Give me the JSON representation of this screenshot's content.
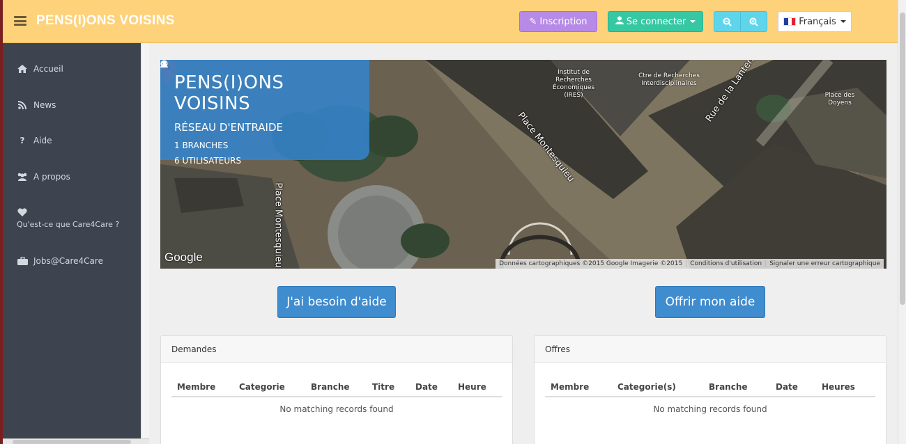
{
  "header": {
    "brand": "PENS(I)ONS VOISINS",
    "signup_label": "Inscription",
    "login_label": "Se connecter",
    "language_label": "Français"
  },
  "sidebar": {
    "items": [
      {
        "label": "Accueil",
        "icon": "home-icon"
      },
      {
        "label": "News",
        "icon": "rss-icon"
      },
      {
        "label": "Aide",
        "icon": "question-icon"
      },
      {
        "label": "A propos",
        "icon": "users-icon"
      },
      {
        "label": "Qu'est-ce que Care4Care ?",
        "icon": "heart-icon"
      },
      {
        "label": "Jobs@Care4Care",
        "icon": "briefcase-icon"
      }
    ]
  },
  "map": {
    "title": "PENS(I)ONS VOISINS",
    "subtitle": "RÉSEAU D'ENTRAIDE",
    "branches": "1 BRANCHES",
    "users": "6 UTILISATEURS",
    "google_logo": "Google",
    "footer_data": "Données cartographiques ©2015 Google Imagerie ©2015",
    "footer_terms": "Conditions d'utilisation",
    "footer_report": "Signaler une erreur cartographique",
    "labels": {
      "ires": "Institut de Recherches Économiques (IRES)",
      "ctre": "Ctre de Recherches Interdisciplinaires",
      "doyens": "Place des Doyens",
      "street1": "Place Montesquieu",
      "street2": "Place Montesquieu",
      "street3": "Rue de la Lanterne"
    }
  },
  "actions": {
    "need_help": "J'ai besoin d'aide",
    "offer_help": "Offrir mon aide"
  },
  "demandes": {
    "title": "Demandes",
    "columns": [
      "Membre",
      "Categorie",
      "Branche",
      "Titre",
      "Date",
      "Heure"
    ],
    "empty": "No matching records found"
  },
  "offres": {
    "title": "Offres",
    "columns": [
      "Membre",
      "Categorie(s)",
      "Branche",
      "Date",
      "Heures"
    ],
    "empty": "No matching records found"
  },
  "colors": {
    "header_bg": "#fdd27a",
    "sidebar_bg": "#3d4450",
    "primary": "#3f8ccf",
    "signup": "#b68ae6",
    "login": "#36c8a3",
    "zoom": "#5fd5eb"
  }
}
